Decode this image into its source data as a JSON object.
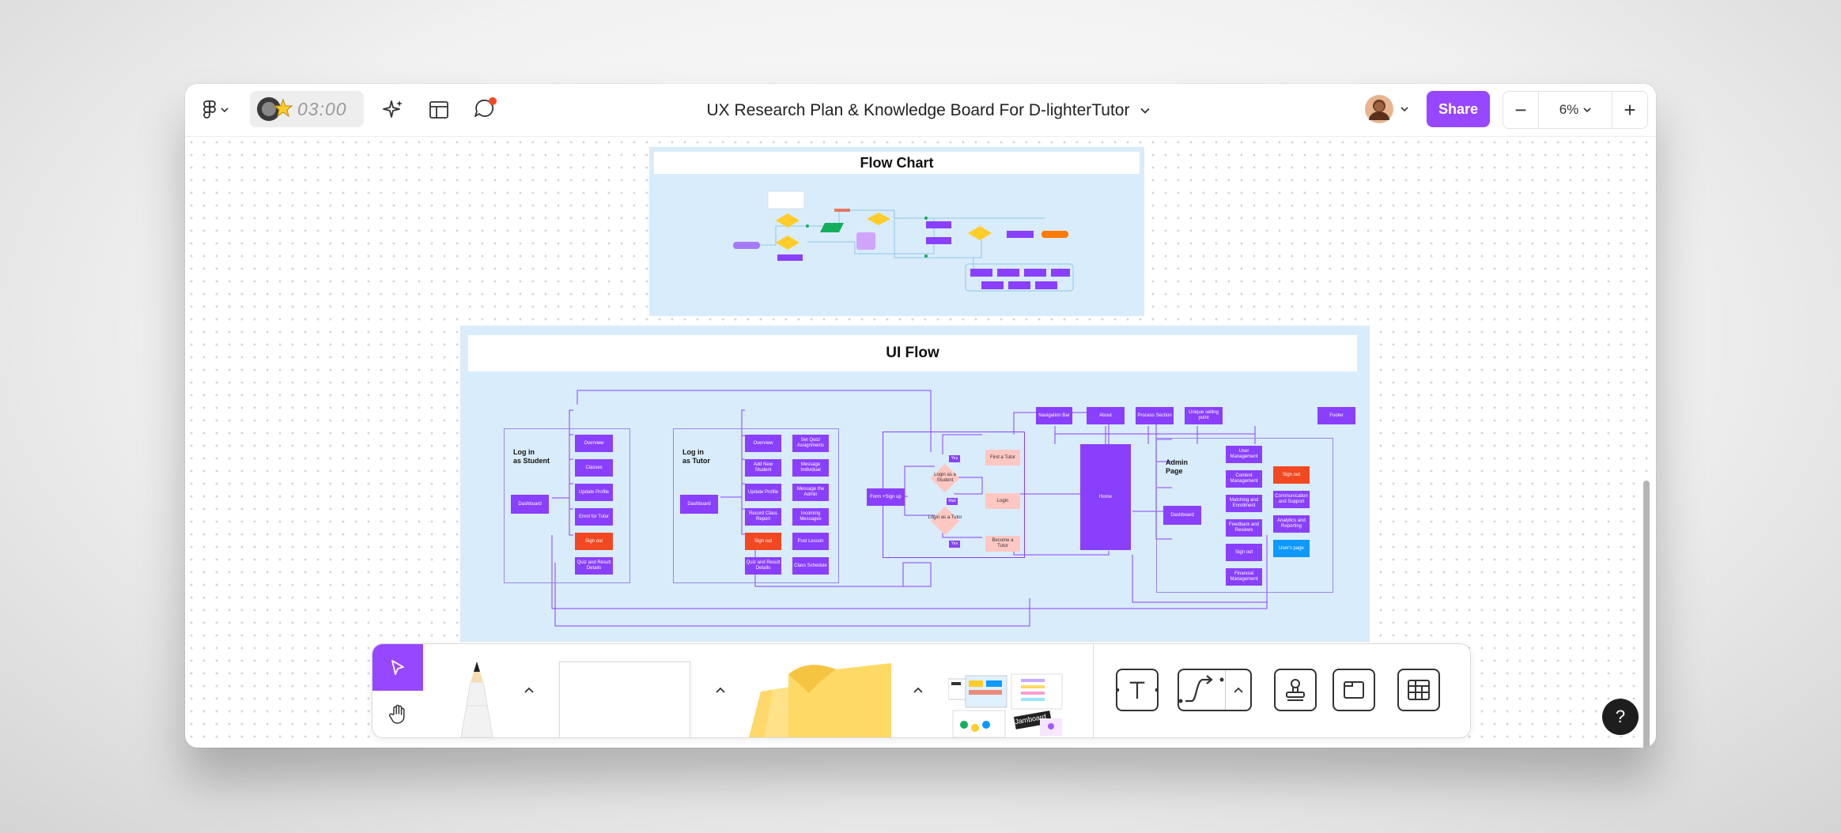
{
  "header": {
    "timer": "03:00",
    "board_title": "UX Research Plan & Knowledge Board For D-lighterTutor",
    "share_label": "Share",
    "zoom_level": "6%",
    "zoom_out": "−",
    "zoom_in": "+"
  },
  "icons": {
    "main_menu": "figma-logo-icon",
    "ai": "sparkle-icon",
    "templates": "layout-icon",
    "comments": "comment-icon",
    "notification_color": "#f24822"
  },
  "colors": {
    "accent": "#9747ff",
    "node_purple": "#8a3ffc",
    "node_red": "#f24822",
    "node_blue": "#0d99ff",
    "node_pink": "#ffc7c2",
    "section_bg": "#d9ecfb"
  },
  "flow_chart": {
    "title": "Flow Chart"
  },
  "ui_flow": {
    "title": "UI Flow",
    "student": {
      "label": "Log in\nas Student",
      "dashboard": "Dashboard",
      "items": [
        "Overview",
        "Classes",
        "Update Profile",
        "Enrol for Tutor",
        "Sign out",
        "Quiz and Result Details"
      ]
    },
    "tutor": {
      "label": "Log in\nas Tutor",
      "dashboard": "Dashboard",
      "col1": [
        "Overview",
        "Add New Student",
        "Update Profile",
        "Record Class Report",
        "Sign out",
        "Quiz and Result Details"
      ],
      "col2": [
        "Set Quiz/ Assignments",
        "Message Individual",
        "Message the Admin",
        "Incoming Messages",
        "Post Lesson",
        "Class Schedule"
      ]
    },
    "auth": {
      "form": "Form +Sign up",
      "login_student": "Login as a Student",
      "login_tutor": "Login as a Tutor",
      "yes1": "Yes",
      "mail": "Mail",
      "yes2": "Yes",
      "find_tutor": "Find a Tutor",
      "login": "Login",
      "become_tutor": "Become a Tutor"
    },
    "site": {
      "nav_bar": "Navigation Bar",
      "about": "About",
      "process": "Process Section",
      "usp": "Unique selling point",
      "footer": "Footer",
      "home": "Home"
    },
    "admin": {
      "label": "Admin\nPage",
      "dashboard": "Dashboard",
      "col1": [
        "User Management",
        "Content Management",
        "Matching and Enrollment",
        "Feedback and Reviews",
        "Sign out",
        "Financial Management"
      ],
      "col2": [
        "Sign out",
        "Communication and Support",
        "Analytics and Reporting",
        "User's page"
      ]
    }
  },
  "toolbar": {
    "stack_label_1": "Jamboard",
    "caret": "^"
  },
  "help_label": "?"
}
